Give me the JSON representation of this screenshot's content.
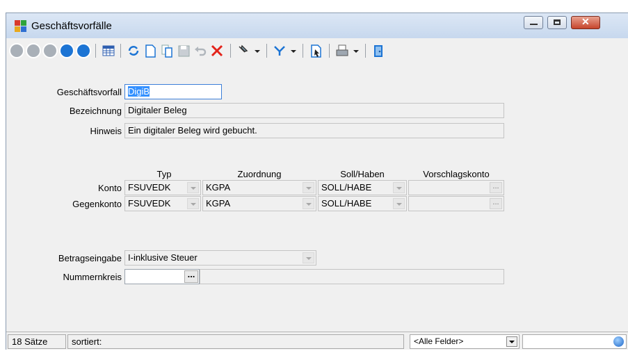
{
  "window": {
    "title": "Geschäftsvorfälle"
  },
  "fields": {
    "geschaeftsvorfall": {
      "label": "Geschäftsvorfall",
      "value": "DigiB"
    },
    "bezeichnung": {
      "label": "Bezeichnung",
      "value": "Digitaler Beleg"
    },
    "hinweis": {
      "label": "Hinweis",
      "value": "Ein digitaler Beleg wird gebucht."
    }
  },
  "grid": {
    "headers": [
      "Typ",
      "Zuordnung",
      "Soll/Haben",
      "Vorschlagskonto"
    ],
    "rows": [
      {
        "label": "Konto",
        "typ": "FSUVEDK",
        "zuordnung": "KGPA",
        "sollhaben": "SOLL/HABE",
        "vorschlag": ""
      },
      {
        "label": "Gegenkonto",
        "typ": "FSUVEDK",
        "zuordnung": "KGPA",
        "sollhaben": "SOLL/HABE",
        "vorschlag": ""
      }
    ]
  },
  "betragseingabe": {
    "label": "Betragseingabe",
    "value": "I-inklusive Steuer"
  },
  "nummernkreis": {
    "label": "Nummernkreis",
    "value": "",
    "button": "..."
  },
  "status": {
    "count": "18 Sätze",
    "sorted": "sortiert:",
    "filter": "<Alle Felder>",
    "search": ""
  }
}
